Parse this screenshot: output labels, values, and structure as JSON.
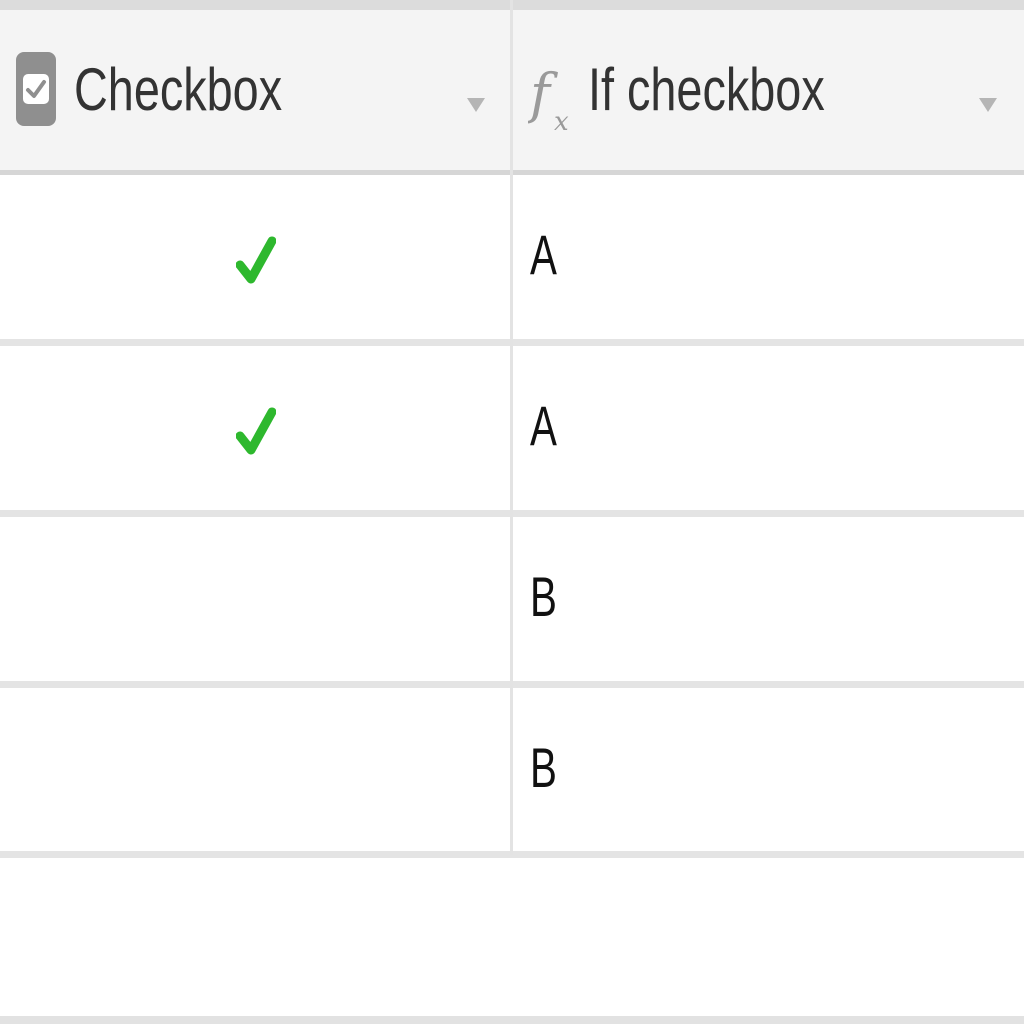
{
  "columns": [
    {
      "label": "Checkbox",
      "icon": "checkbox-field-icon"
    },
    {
      "label": "If checkbox",
      "icon": "formula-fx-icon"
    }
  ],
  "rows": [
    {
      "checked": true,
      "value": "A"
    },
    {
      "checked": true,
      "value": "A"
    },
    {
      "checked": false,
      "value": "B"
    },
    {
      "checked": false,
      "value": "B"
    }
  ],
  "colors": {
    "check": "#2eb82e",
    "header_bg": "#f4f4f4",
    "text": "#333333"
  }
}
